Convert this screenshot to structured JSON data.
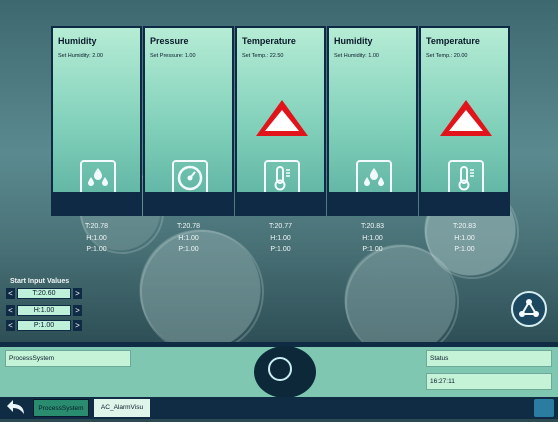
{
  "cards": [
    {
      "title": "Humidity",
      "setpoint": "Set Humidity: 2.00",
      "icon": "humidity-drops-icon",
      "alarm": false,
      "readout": {
        "t": "T:20.78",
        "h": "H:1.00",
        "p": "P:1.00"
      }
    },
    {
      "title": "Pressure",
      "setpoint": "Set Pressure: 1.00",
      "icon": "pressure-gauge-icon",
      "alarm": false,
      "readout": {
        "t": "T:20.78",
        "h": "H:1.00",
        "p": "P:1.00"
      }
    },
    {
      "title": "Temperature",
      "setpoint": "Set Temp.: 22.50",
      "icon": "thermometer-icon",
      "alarm": true,
      "readout": {
        "t": "T:20.77",
        "h": "H:1.00",
        "p": "P:1.00"
      }
    },
    {
      "title": "Humidity",
      "setpoint": "Set Humidity: 1.00",
      "icon": "humidity-drops-icon",
      "alarm": false,
      "readout": {
        "t": "T:20.83",
        "h": "H:1.00",
        "p": "P:1.00"
      }
    },
    {
      "title": "Temperature",
      "setpoint": "Set Temp.: 20.00",
      "icon": "thermometer-icon",
      "alarm": true,
      "readout": {
        "t": "T:20.83",
        "h": "H:1.00",
        "p": "P:1.00"
      }
    }
  ],
  "input_panel": {
    "title": "Start Input Values",
    "rows": [
      {
        "value": "T:20.60",
        "left": "<",
        "right": ">"
      },
      {
        "value": "H:1.00",
        "left": "<",
        "right": ">"
      },
      {
        "value": "P:1.00",
        "left": "<",
        "right": ">"
      }
    ]
  },
  "footer": {
    "process_field": "ProcessSystem",
    "status_field": "Status",
    "time_field": "16:27:11"
  },
  "taskbar": {
    "buttons": [
      {
        "label": "ProcessSystem",
        "active": true
      },
      {
        "label": "AC_AlarmVisu",
        "active": false
      }
    ],
    "back_icon": "back-arrow-icon"
  },
  "share_icon": "network-share-icon",
  "colors": {
    "card_top": "#b6ecd5",
    "card_bottom": "#5aaf9f",
    "navy": "#0e2a45",
    "alarm_red": "#e0141a",
    "panel": "#7fc7b1"
  }
}
